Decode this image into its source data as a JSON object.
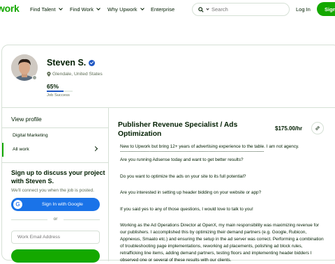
{
  "header": {
    "logo": "work",
    "nav": [
      {
        "label": "Find Talent",
        "has_dropdown": true
      },
      {
        "label": "Find Work",
        "has_dropdown": true
      },
      {
        "label": "Why Upwork",
        "has_dropdown": true
      },
      {
        "label": "Enterprise",
        "has_dropdown": false
      }
    ],
    "search_placeholder": "Search",
    "login_label": "Log In",
    "signup_label": "Sign"
  },
  "profile": {
    "name": "Steven S.",
    "location": "Glendale, United States",
    "job_success_pct": "65%",
    "job_success_fraction": 0.65,
    "job_success_label": "Job Success"
  },
  "sidebar": {
    "view_profile": "View profile",
    "items": [
      {
        "label": "Digital Marketing",
        "active": false
      },
      {
        "label": "All work",
        "active": true
      }
    ],
    "signup_heading": "Sign up to discuss your project with Steven S.",
    "signup_sub": "We'll connect you when the job is posted.",
    "google_button": "Sign In with Google",
    "or_label": "or",
    "email_placeholder": "Work Email Address"
  },
  "main": {
    "title": "Publisher Revenue Specialist / Ads Optimization",
    "rate": "$175.00/hr",
    "paragraphs": [
      "New to Upwork but bring 12+ years of advertising experience to the table. I am not agency.",
      "-------------------------------------------------------------------------------------------------",
      "Are you running Adsense today and want to get better results?",
      "Do you want to optimize the ads on your site to its full potential?",
      "Are you interested in setting up header bidding on your website or app?",
      "If you said yes to any of those questions, I would love to talk to you!",
      "Working as the Ad Operations Director at OpenX, my main responsibility was maximizing revenue for our publishers. I accomplished this by optimizing their demand partners (e.g. Google, Rubicon, Appnexus, Smaato etc.) and ensuring the setup in the ad server was correct. Performing a combination of troubleshooting page implementations, reworking ad placements, polishing ad block rules, retrafficking line items, adding demand partners, testing floors and implementing header bidders I observed one or several of these results with our clients."
    ]
  },
  "colors": {
    "brand": "#14a800",
    "google": "#1a73e8",
    "verified": "#1f57c3"
  }
}
